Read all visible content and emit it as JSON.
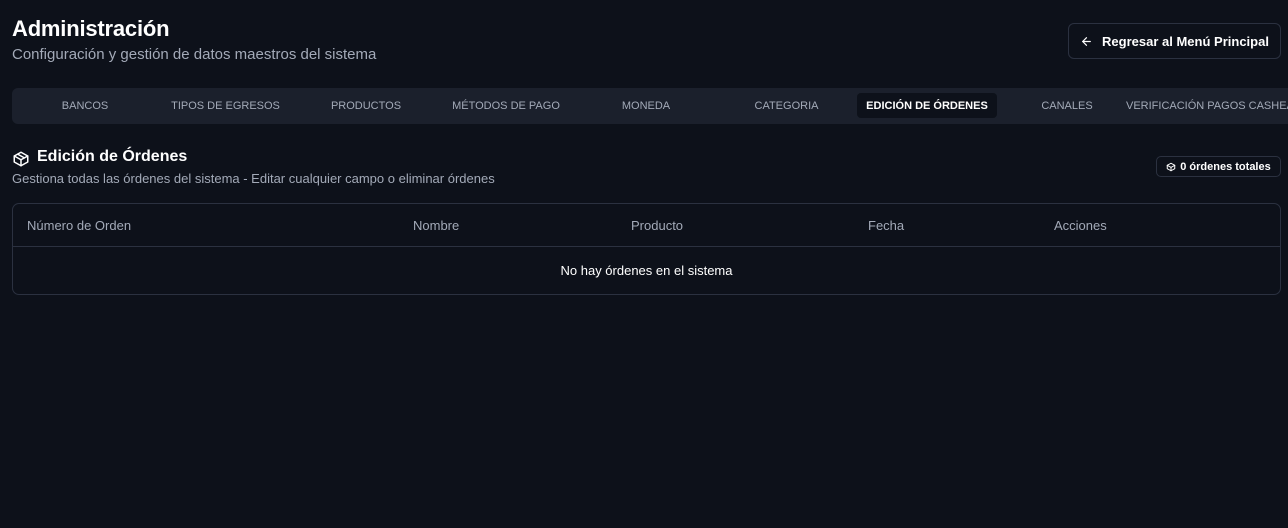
{
  "header": {
    "title": "Administración",
    "subtitle": "Configuración y gestión de datos maestros del sistema",
    "back_button": "Regresar al Menú Principal"
  },
  "tabs": [
    {
      "label": "BANCOS",
      "active": false
    },
    {
      "label": "TIPOS DE EGRESOS",
      "active": false
    },
    {
      "label": "PRODUCTOS",
      "active": false
    },
    {
      "label": "MÉTODOS DE PAGO",
      "active": false
    },
    {
      "label": "MONEDA",
      "active": false
    },
    {
      "label": "CATEGORIA",
      "active": false
    },
    {
      "label": "EDICIÓN DE ÓRDENES",
      "active": true
    },
    {
      "label": "CANALES",
      "active": false
    },
    {
      "label": "VERIFICACIÓN PAGOS CASHEA",
      "active": false
    }
  ],
  "section": {
    "icon": "package-icon",
    "title": "Edición de Órdenes",
    "description": "Gestiona todas las órdenes del sistema - Editar cualquier campo o eliminar órdenes",
    "count_label": "0 órdenes totales"
  },
  "table": {
    "columns": [
      "Número de Orden",
      "Nombre",
      "Producto",
      "Fecha",
      "Acciones"
    ],
    "rows": [],
    "empty_message": "No hay órdenes en el sistema"
  },
  "colors": {
    "background": "#0d111a",
    "tab_bar": "#1b202c",
    "border": "#2b3140",
    "muted_text": "#a3aab8"
  }
}
